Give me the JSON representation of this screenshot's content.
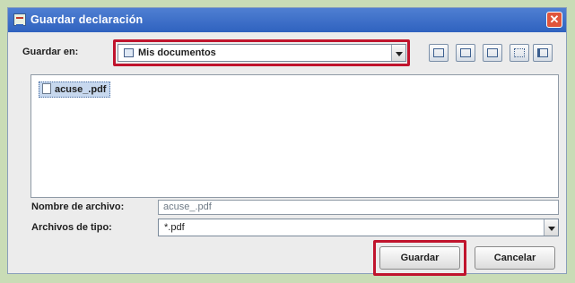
{
  "dialog": {
    "title": "Guardar declaración",
    "close_glyph": "✕"
  },
  "location": {
    "label": "Guardar en:",
    "value": "Mis documentos"
  },
  "toolbar": {
    "icons": [
      "up-folder-icon",
      "home-icon",
      "new-folder-icon",
      "list-view-icon",
      "details-view-icon"
    ]
  },
  "files": [
    {
      "name": "acuse_.pdf"
    }
  ],
  "filename": {
    "label": "Nombre de archivo:",
    "value": "acuse_.pdf"
  },
  "filetype": {
    "label": "Archivos de tipo:",
    "value": "*.pdf"
  },
  "buttons": {
    "save_label": "Guardar",
    "cancel_label": "Cancelar"
  },
  "colors": {
    "highlight": "#c0142d",
    "titlebar": "#2f62bf"
  }
}
